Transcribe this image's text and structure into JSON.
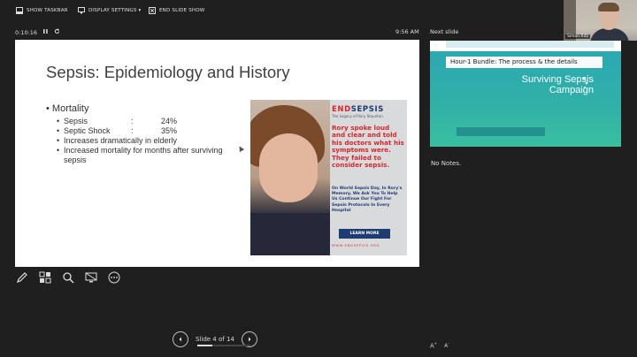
{
  "toolbar": {
    "show_taskbar": "SHOW TASKBAR",
    "display_settings": "DISPLAY SETTINGS ▾",
    "end_slide_show": "END SLIDE SHOW"
  },
  "presenter": {
    "timer": "0:10:16",
    "clock": "9:56 AM",
    "next_slide_label": "Next slide",
    "notes": "No Notes.",
    "slide_counter": "Slide 4 of 14",
    "progress_fraction": 0.2857
  },
  "current_slide": {
    "title": "Sepsis: Epidemiology and History",
    "bullet": "Mortality",
    "stats": [
      {
        "name": "Sepsis",
        "colon": ":",
        "value": "24%"
      },
      {
        "name": "Septic Shock",
        "colon": ":",
        "value": "35%"
      }
    ],
    "sub_bullets": [
      "Increases dramatically in elderly",
      "Increased mortality for months after surviving sepsis"
    ],
    "image": {
      "logo_end": "END",
      "logo_sepsis": "SEPSIS",
      "subtitle": "The Legacy of Rory Staunton",
      "headline": "Rory spoke loud and clear and told his doctors what his symptoms were. They failed to consider sepsis.",
      "body": "On World Sepsis Day, In Rory's Memory, We Ask You To Help Us Continue Our Fight For Sepsis Protocols In Every Hospital",
      "button": "LEARN MORE",
      "url": "WWW.ENDSEPSIS.ORG"
    }
  },
  "next_slide": {
    "title": "Hour-1 Bundle: The process & the details",
    "campaign": "Surviving Sepsis Campaign"
  },
  "video": {
    "name": "Simon Ritz"
  },
  "colors": {
    "background": "#1f1f1f",
    "accent_red": "#d8262b",
    "navy": "#1f3b73",
    "teal": "#2aa7b3"
  }
}
